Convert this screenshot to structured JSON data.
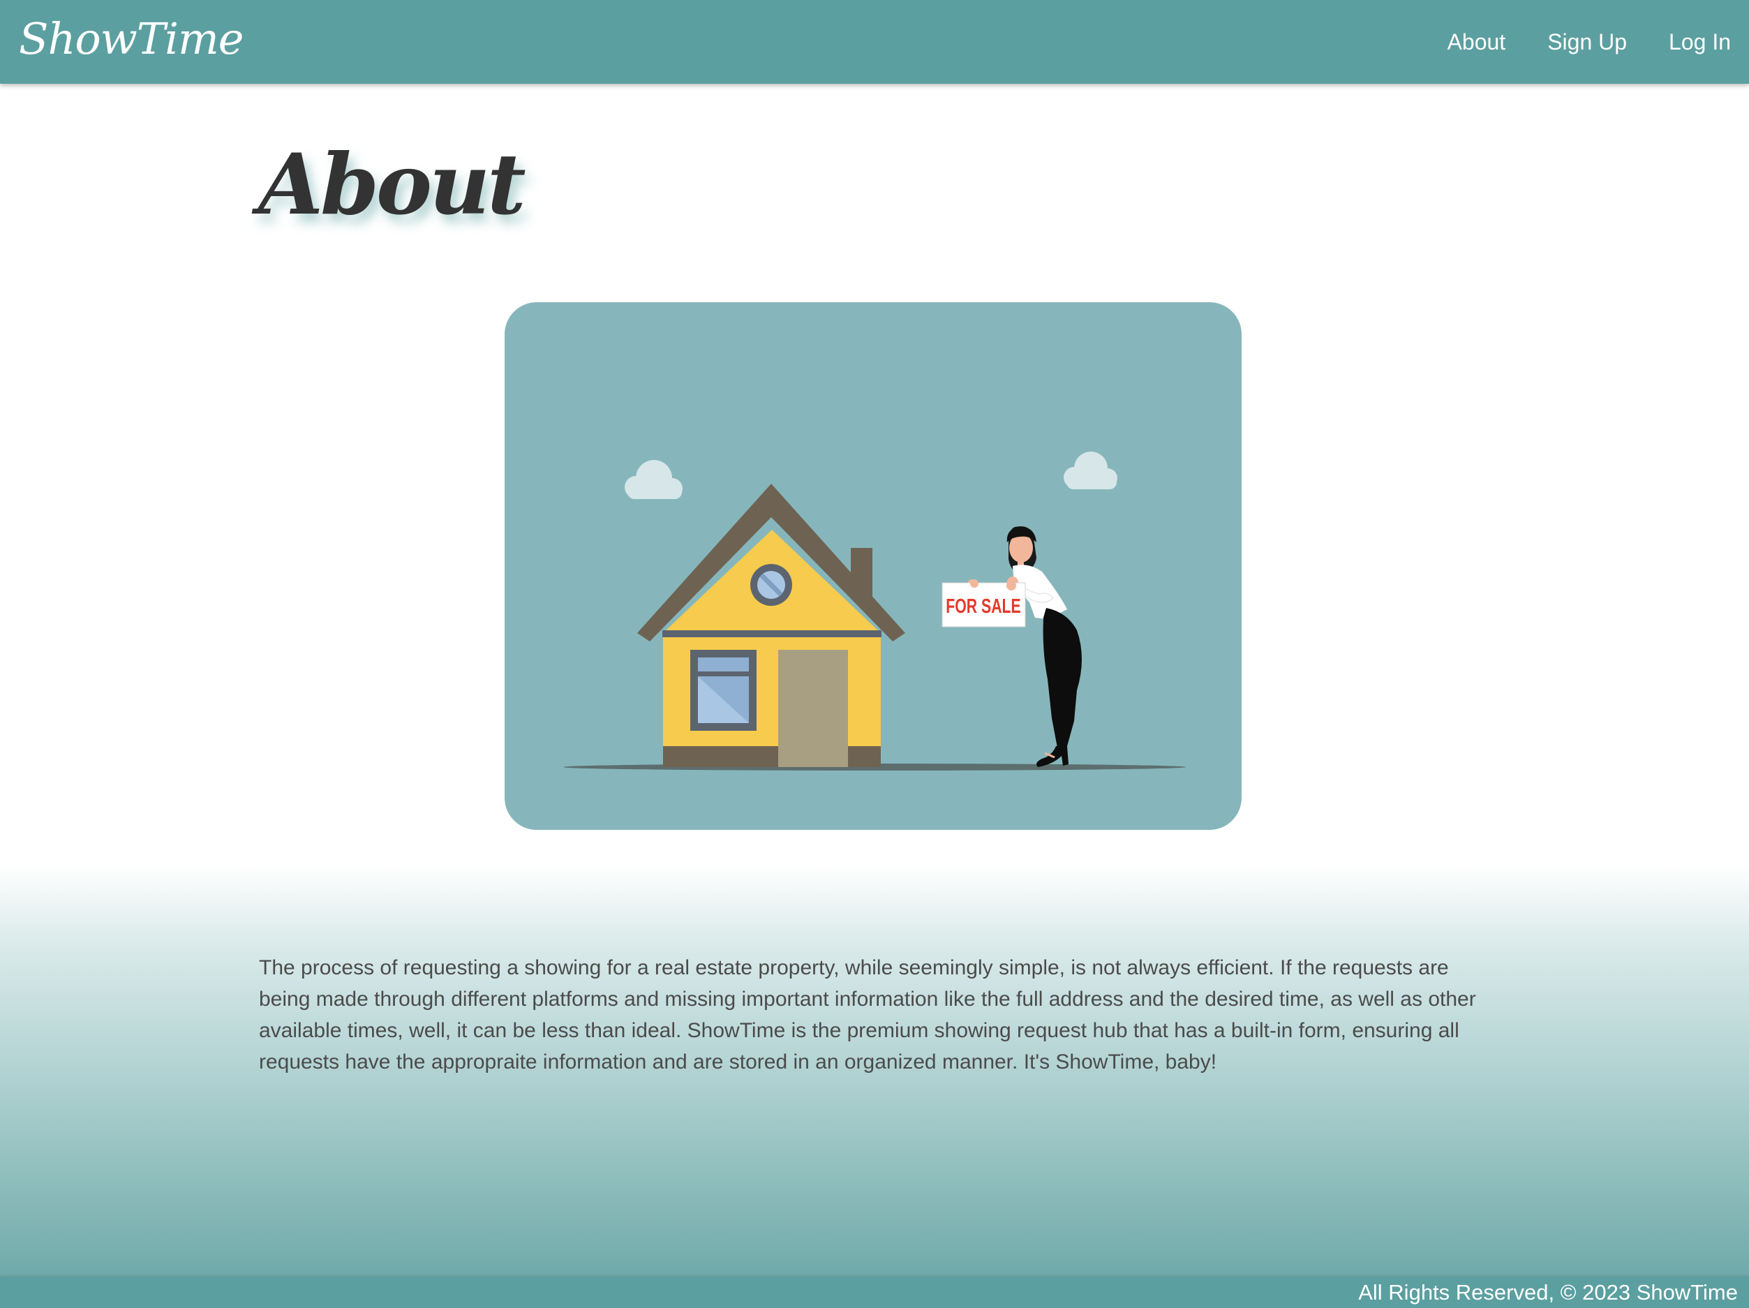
{
  "navbar": {
    "brand": "ShowTime",
    "links": [
      {
        "label": "About"
      },
      {
        "label": "Sign Up"
      },
      {
        "label": "Log In"
      }
    ]
  },
  "main": {
    "title": "About",
    "illustration": {
      "sign_text": "FOR SALE"
    },
    "paragraph": "The process of requesting a showing for a real estate property, while seemingly simple, is not always efficient. If the requests are being made through different platforms and missing important information like the full address and the desired time, as well as other available times, well, it can be less than ideal. ShowTime is the premium showing request hub that has a built-in form, ensuring all requests have the appropraite information and are stored in an organized manner. It's ShowTime, baby!"
  },
  "footer": {
    "text": "All Rights Reserved, © 2023 ShowTime"
  },
  "colors": {
    "primary": "#5c9fa0",
    "card": "#86b6bb",
    "text": "#4b4b4b",
    "title": "#333333",
    "house_wall": "#f7cb4d",
    "house_roof": "#6e6352",
    "sign_text": "#e33a2b"
  }
}
